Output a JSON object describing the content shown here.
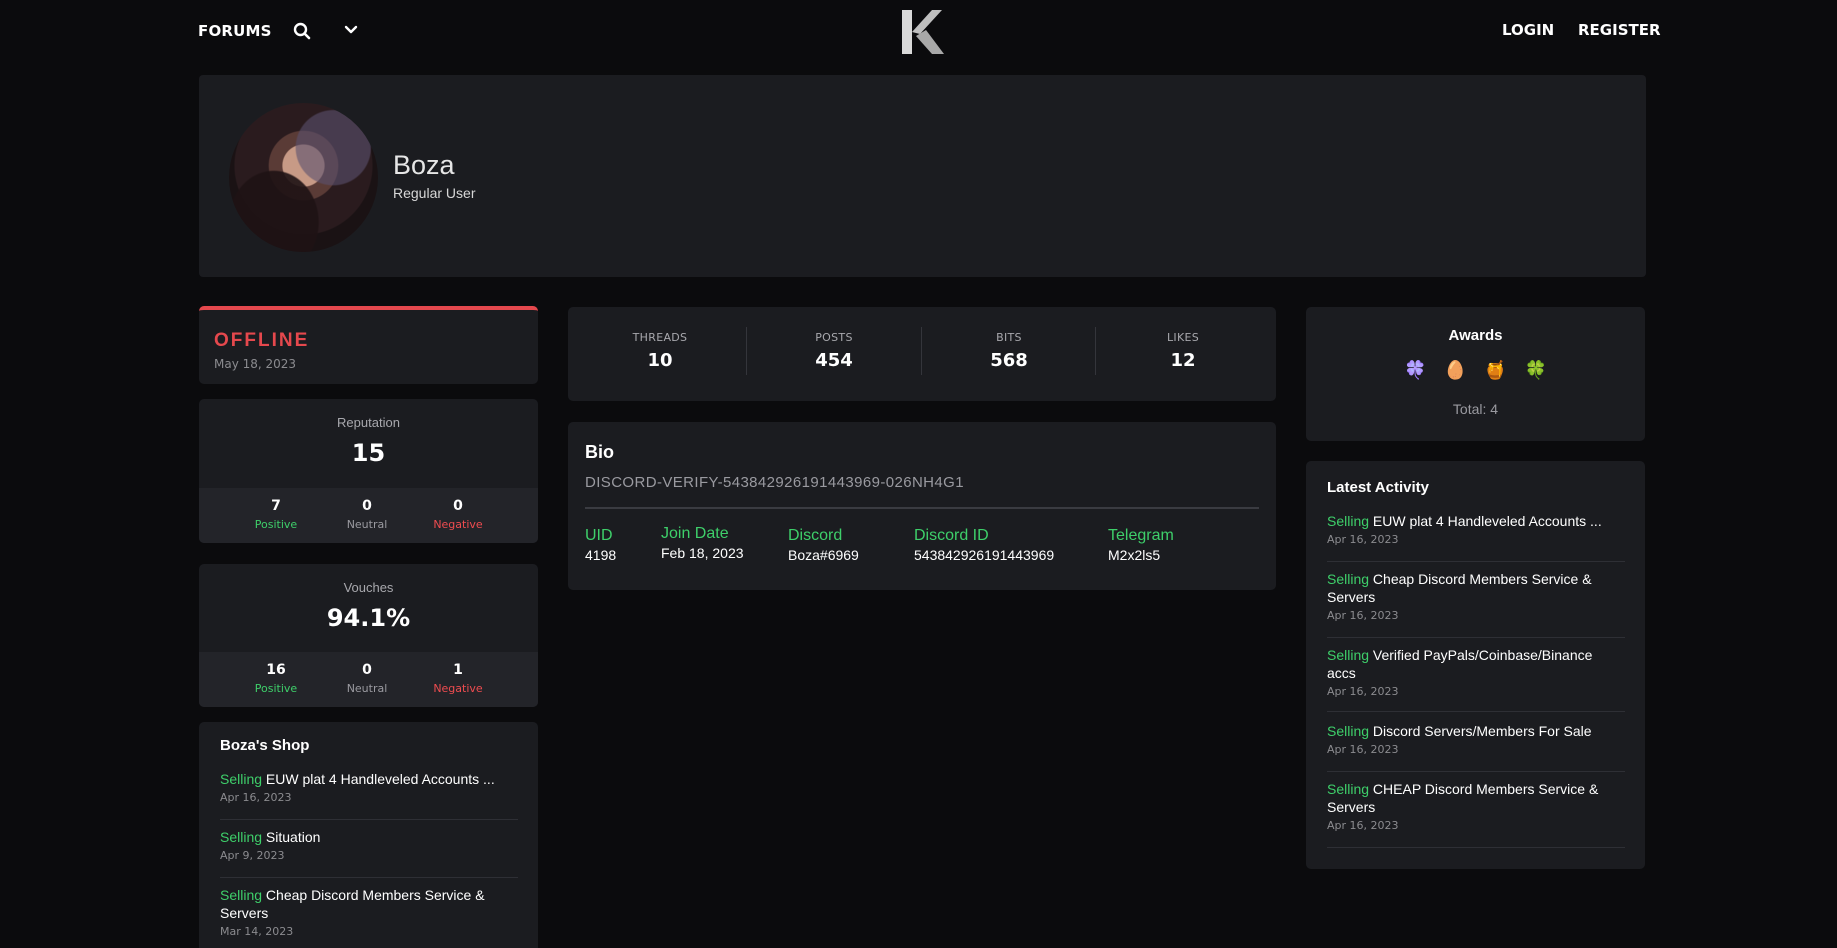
{
  "nav": {
    "forums": "FORUMS",
    "login": "LOGIN",
    "register": "REGISTER"
  },
  "profile": {
    "name": "Boza",
    "title": "Regular User"
  },
  "status": {
    "text": "OFFLINE",
    "date": "May 18, 2023"
  },
  "reputation": {
    "label": "Reputation",
    "value": "15",
    "positive": "7",
    "neutral": "0",
    "negative": "0",
    "positive_label": "Positive",
    "neutral_label": "Neutral",
    "negative_label": "Negative"
  },
  "vouches": {
    "label": "Vouches",
    "value": "94.1%",
    "positive": "16",
    "neutral": "0",
    "negative": "1",
    "positive_label": "Positive",
    "neutral_label": "Neutral",
    "negative_label": "Negative"
  },
  "shop": {
    "title": "Boza's Shop",
    "items": [
      {
        "tag": "Selling",
        "title": "EUW plat 4 Handleveled Accounts ...",
        "date": "Apr 16, 2023"
      },
      {
        "tag": "Selling",
        "title": "Situation",
        "date": "Apr 9, 2023"
      },
      {
        "tag": "Selling",
        "title": "Cheap Discord Members Service & Servers",
        "date": "Mar 14, 2023"
      }
    ]
  },
  "counts": [
    {
      "label": "THREADS",
      "value": "10"
    },
    {
      "label": "POSTS",
      "value": "454"
    },
    {
      "label": "BITS",
      "value": "568"
    },
    {
      "label": "LIKES",
      "value": "12"
    }
  ],
  "bio": {
    "title": "Bio",
    "text": "DISCORD-VERIFY-543842926191443969-026NH4G1",
    "fields": [
      {
        "key": "UID",
        "value": "4198"
      },
      {
        "key": "Join Date",
        "value": "Feb 18, 2023"
      },
      {
        "key": "Discord",
        "value": "Boza#6969"
      },
      {
        "key": "Discord ID",
        "value": "543842926191443969"
      },
      {
        "key": "Telegram",
        "value": "M2x2ls5"
      }
    ]
  },
  "awards": {
    "title": "Awards",
    "icons": [
      "🍀",
      "🥚",
      "🍯",
      "🍀"
    ],
    "icon_names": [
      "purple-clover-award-icon",
      "egg-award-icon",
      "pot-award-icon",
      "clover-award-icon"
    ],
    "total": "Total: 4"
  },
  "latest": {
    "title": "Latest Activity",
    "items": [
      {
        "tag": "Selling",
        "title": "EUW plat 4 Handleveled Accounts ...",
        "date": "Apr 16, 2023"
      },
      {
        "tag": "Selling",
        "title": "Cheap Discord Members Service & Servers",
        "date": "Apr 16, 2023"
      },
      {
        "tag": "Selling",
        "title": "Verified PayPals/Coinbase/Binance accs",
        "date": "Apr 16, 2023"
      },
      {
        "tag": "Selling",
        "title": "Discord Servers/Members For Sale",
        "date": "Apr 16, 2023"
      },
      {
        "tag": "Selling",
        "title": "CHEAP Discord Members Service & Servers",
        "date": "Apr 16, 2023"
      }
    ]
  },
  "colors": {
    "background": "#0b0b0d",
    "card": "#1b1c20",
    "accent_green": "#3ecf6a",
    "accent_red": "#ef4c50"
  }
}
